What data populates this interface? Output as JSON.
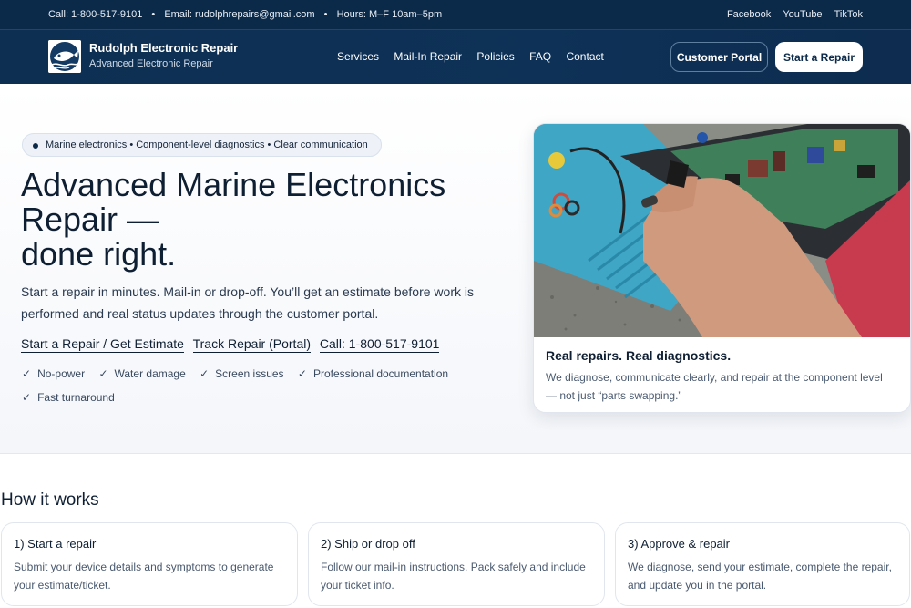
{
  "topbar": {
    "phone": "Call: 1-800-517-9101",
    "email": "Email: rudolphrepairs@gmail.com",
    "hours": "Hours: M–F 10am–5pm",
    "separator": "•",
    "social": [
      "Facebook",
      "YouTube",
      "TikTok"
    ]
  },
  "header": {
    "brand_name": "Rudolph Electronic Repair",
    "brand_sub": "Advanced Electronic Repair",
    "nav": [
      "Services",
      "Mail-In Repair",
      "Policies",
      "FAQ",
      "Contact"
    ],
    "portal_button": "Customer Portal",
    "start_button": "Start a Repair"
  },
  "hero": {
    "pill": "Marine electronics • Component-level diagnostics • Clear communication",
    "title_lines": [
      "Advanced Marine Electronics",
      "Repair —",
      "done right."
    ],
    "text": "Start a repair in minutes. Mail-in or drop-off. You’ll get an estimate before work is performed and real status updates through the customer portal.",
    "links": [
      "Start a Repair / Get Estimate",
      "Track Repair (Portal)",
      "Call: 1-800-517-9101"
    ],
    "check_glyph": "✓",
    "checks": [
      "No-power",
      "Water damage",
      "Screen issues",
      "Professional documentation",
      "Fast turnaround"
    ]
  },
  "card": {
    "title": "Real repairs. Real diagnostics.",
    "text": "We diagnose, communicate clearly, and repair at the component level — not just “parts swapping.”"
  },
  "how": {
    "title": "How it works",
    "steps": [
      {
        "title": "1) Start a repair",
        "text": "Submit your device details and symptoms to generate your estimate/ticket."
      },
      {
        "title": "2) Ship or drop off",
        "text": "Follow our mail-in instructions. Pack safely and include your ticket info."
      },
      {
        "title": "3) Approve & repair",
        "text": "We diagnose, send your estimate, complete the repair, and update you in the portal."
      }
    ]
  },
  "colors": {
    "navy": "#0b2a4a",
    "header": "#0e3157",
    "text": "#0f1f33",
    "muted": "#4a5a70"
  }
}
